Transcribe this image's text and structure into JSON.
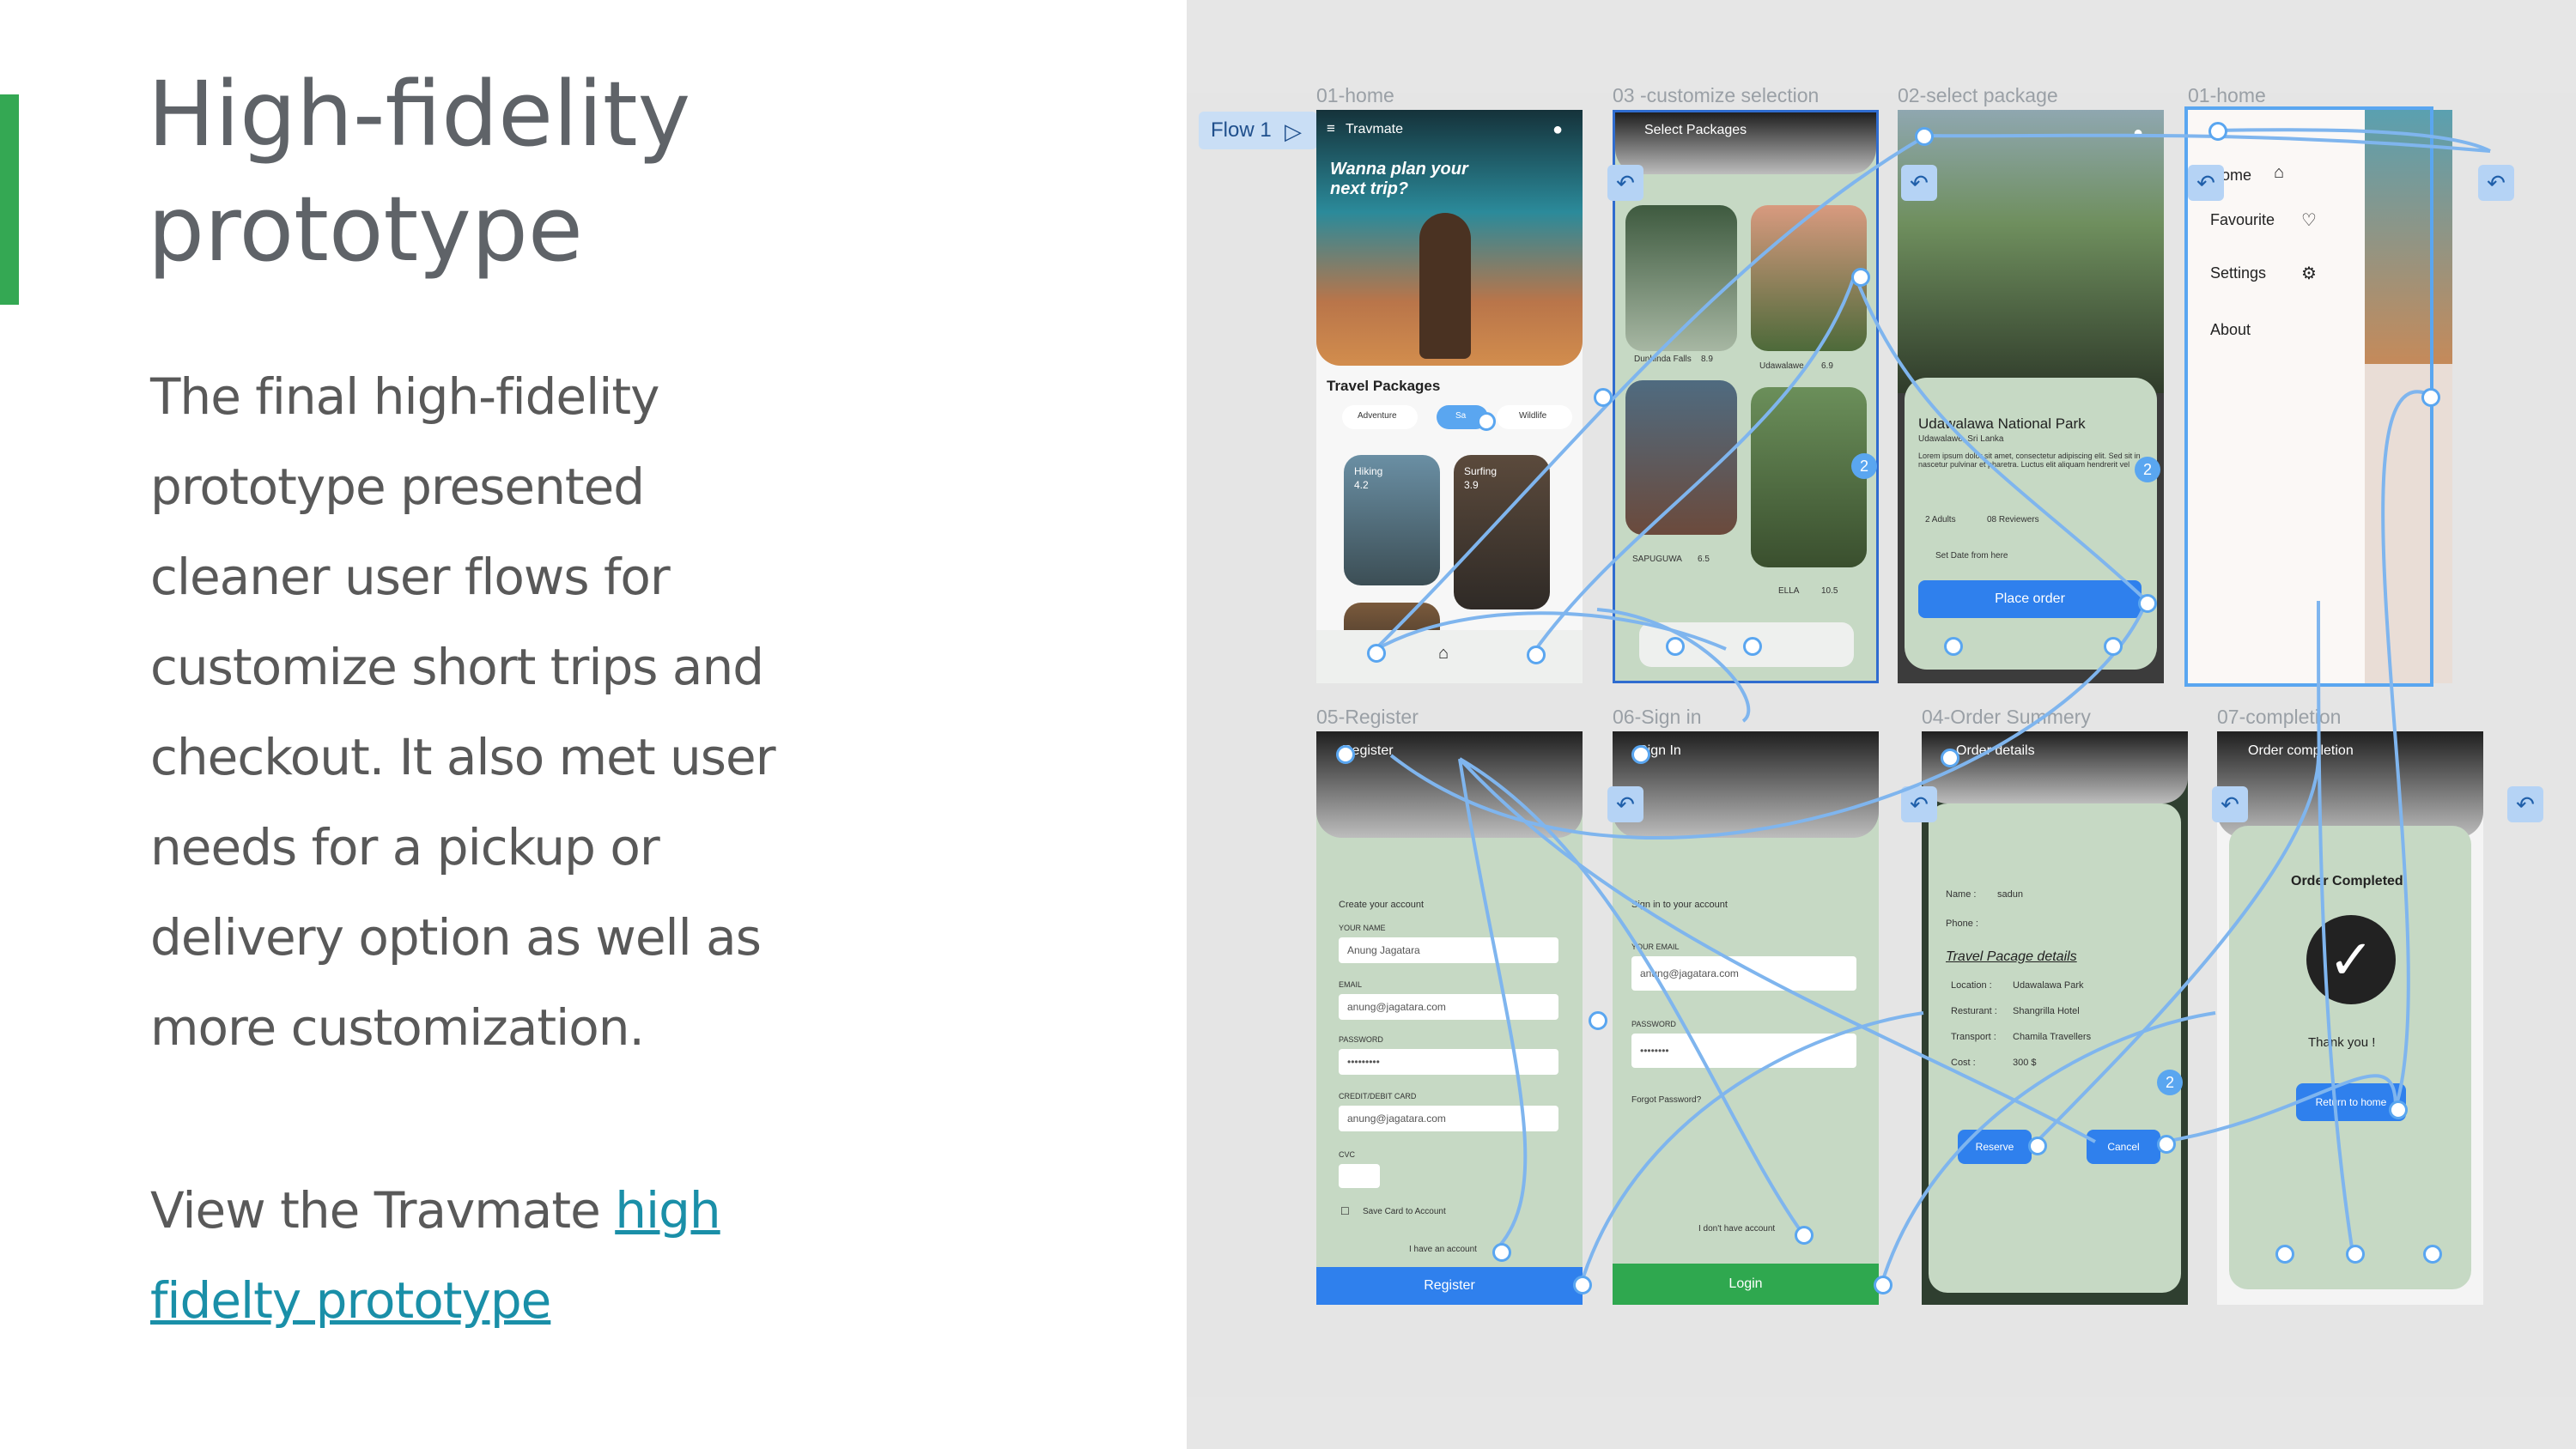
{
  "slide": {
    "title": "High-fidelity prototype",
    "body": "The final high-fidelity prototype presented cleaner user flows for customize short trips and checkout. It also met user needs for a pickup or delivery option as well as more customization.",
    "view_prefix": "View the Travmate ",
    "view_link": "high fidelty prototype",
    "accent_color": "#34a853",
    "link_color": "#1a8fa8"
  },
  "prototype": {
    "flow_label": "Flow 1",
    "frames": {
      "home": "01-home",
      "customize": "03 -customize selection",
      "select": "02-select package",
      "home_menu": "01-home",
      "register": "05-Register",
      "signin": "06-Sign in",
      "order_summary": "04-Order Summery",
      "completion": "07-completion"
    },
    "home": {
      "app_name": "Travmate",
      "hero": "Wanna plan your next trip?",
      "section": "Travel Packages",
      "chips": [
        "Adventure",
        "Sa",
        "Wildlife"
      ],
      "cards": [
        {
          "name": "Hiking",
          "rating": "4.2"
        },
        {
          "name": "Surfing",
          "rating": "3.9"
        }
      ]
    },
    "customize": {
      "header": "Select Packages",
      "items": [
        {
          "name": "Dunhinda Falls",
          "rating": "8.9"
        },
        {
          "name": "Udawalawe",
          "rating": "6.9"
        },
        {
          "name": "SAPUGUWA",
          "rating": "6.5"
        },
        {
          "name": "ELLA",
          "rating": "10.5"
        }
      ]
    },
    "select": {
      "place": "Udawalawa National Park",
      "region": "Udawalawe, Sri Lanka",
      "desc": "Lorem ipsum dolor sit amet, consectetur adipiscing elit. Sed sit in nascetur pulvinar et pharetra. Luctus elit aliquam hendrerit vel",
      "meta1": "2 Adults",
      "meta2": "08 Reviewers",
      "meta3": "Set Date from here",
      "cta": "Place order"
    },
    "menu": {
      "items": [
        "Home",
        "Favourite",
        "Settings",
        "About"
      ]
    },
    "register": {
      "header": "Register",
      "intro": "Create your account",
      "name_label": "YOUR NAME",
      "name_value": "Anung Jagatara",
      "email_label": "EMAIL",
      "email_value": "anung@jagatara.com",
      "password_label": "PASSWORD",
      "password_value": "•••••••••",
      "card_label": "CREDIT/DEBIT CARD",
      "card_value": "anung@jagatara.com",
      "cvc_label": "CVC",
      "save_card": "Save Card to Account",
      "have_account": "I have an account",
      "cta": "Register"
    },
    "signin": {
      "header": "Sign In",
      "intro": "Sign in to your account",
      "email_label": "YOUR EMAIL",
      "email_value": "anung@jagatara.com",
      "password_label": "PASSWORD",
      "password_value": "••••••••",
      "forgot": "Forgot Password?",
      "no_account": "I don't have account",
      "cta": "Login"
    },
    "order": {
      "header": "Order details",
      "name_label": "Name :",
      "name_value": "sadun",
      "phone_label": "Phone :",
      "section": "Travel Pacage details",
      "location_label": "Location :",
      "location_value": "Udawalawa Park",
      "restaurant_label": "Resturant :",
      "restaurant_value": "Shangrilla Hotel",
      "transport_label": "Transport :",
      "transport_value": "Chamila Travellers",
      "cost_label": "Cost :",
      "cost_value": "300 $",
      "reserve": "Reserve",
      "cancel": "Cancel"
    },
    "completion": {
      "header": "Order completion",
      "title": "Order Completed",
      "thanks": "Thank you !",
      "cta": "Return to home"
    },
    "badges": [
      "2",
      "2",
      "2"
    ]
  }
}
